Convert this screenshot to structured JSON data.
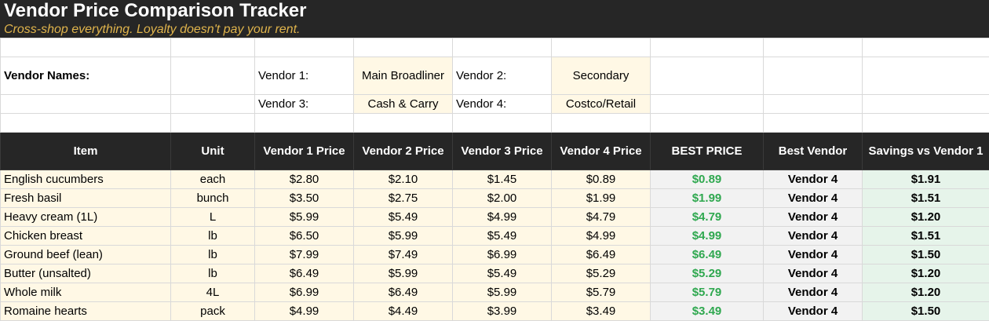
{
  "title": "Vendor Price Comparison Tracker",
  "subtitle": "Cross-shop everything. Loyalty doesn't pay your rent.",
  "vendor_setup": {
    "label": "Vendor Names:",
    "v1_label": "Vendor 1:",
    "v1_name": "Main Broadliner",
    "v2_label": "Vendor 2:",
    "v2_name": "Secondary",
    "v3_label": "Vendor 3:",
    "v3_name": "Cash & Carry",
    "v4_label": "Vendor 4:",
    "v4_name": "Costco/Retail"
  },
  "headers": {
    "item": "Item",
    "unit": "Unit",
    "v1": "Vendor 1 Price",
    "v2": "Vendor 2 Price",
    "v3": "Vendor 3 Price",
    "v4": "Vendor 4 Price",
    "best_price": "BEST PRICE",
    "best_vendor": "Best Vendor",
    "savings": "Savings vs Vendor 1"
  },
  "rows": [
    {
      "item": "English cucumbers",
      "unit": "each",
      "v1": "$2.80",
      "v2": "$2.10",
      "v3": "$1.45",
      "v4": "$0.89",
      "best": "$0.89",
      "best_vendor": "Vendor 4",
      "savings": "$1.91"
    },
    {
      "item": "Fresh basil",
      "unit": "bunch",
      "v1": "$3.50",
      "v2": "$2.75",
      "v3": "$2.00",
      "v4": "$1.99",
      "best": "$1.99",
      "best_vendor": "Vendor 4",
      "savings": "$1.51"
    },
    {
      "item": "Heavy cream (1L)",
      "unit": "L",
      "v1": "$5.99",
      "v2": "$5.49",
      "v3": "$4.99",
      "v4": "$4.79",
      "best": "$4.79",
      "best_vendor": "Vendor 4",
      "savings": "$1.20"
    },
    {
      "item": "Chicken breast",
      "unit": "lb",
      "v1": "$6.50",
      "v2": "$5.99",
      "v3": "$5.49",
      "v4": "$4.99",
      "best": "$4.99",
      "best_vendor": "Vendor 4",
      "savings": "$1.51"
    },
    {
      "item": "Ground beef (lean)",
      "unit": "lb",
      "v1": "$7.99",
      "v2": "$7.49",
      "v3": "$6.99",
      "v4": "$6.49",
      "best": "$6.49",
      "best_vendor": "Vendor 4",
      "savings": "$1.50"
    },
    {
      "item": "Butter (unsalted)",
      "unit": "lb",
      "v1": "$6.49",
      "v2": "$5.99",
      "v3": "$5.49",
      "v4": "$5.29",
      "best": "$5.29",
      "best_vendor": "Vendor 4",
      "savings": "$1.20"
    },
    {
      "item": "Whole milk",
      "unit": "4L",
      "v1": "$6.99",
      "v2": "$6.49",
      "v3": "$5.99",
      "v4": "$5.79",
      "best": "$5.79",
      "best_vendor": "Vendor 4",
      "savings": "$1.20"
    },
    {
      "item": "Romaine hearts",
      "unit": "pack",
      "v1": "$4.99",
      "v2": "$4.49",
      "v3": "$3.99",
      "v4": "$3.49",
      "best": "$3.49",
      "best_vendor": "Vendor 4",
      "savings": "$1.50"
    }
  ]
}
